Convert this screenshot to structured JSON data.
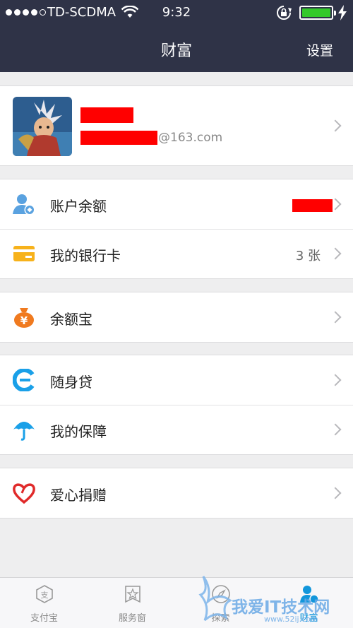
{
  "status_bar": {
    "carrier": "TD-SCDMA",
    "time": "9:32",
    "signal_bars_filled": 4,
    "signal_bars_total": 5,
    "battery_color": "#34c92a",
    "icons": [
      "wifi-icon",
      "rotation-lock-icon",
      "battery-icon",
      "charging-icon"
    ]
  },
  "nav": {
    "title": "财富",
    "settings_label": "设置"
  },
  "profile": {
    "email_domain": "@163.com"
  },
  "groups": [
    [
      {
        "label": "账户余额",
        "value": "",
        "icon": "account-balance-icon"
      },
      {
        "label": "我的银行卡",
        "value": "3 张",
        "icon": "bank-card-icon"
      }
    ],
    [
      {
        "label": "余额宝",
        "icon": "yuebao-bag-icon"
      }
    ],
    [
      {
        "label": "随身贷",
        "icon": "loan-icon"
      },
      {
        "label": "我的保障",
        "icon": "umbrella-icon"
      }
    ],
    [
      {
        "label": "爱心捐赠",
        "icon": "heart-icon"
      }
    ]
  ],
  "tabs": [
    {
      "label": "支付宝",
      "icon": "alipay-icon",
      "active": false
    },
    {
      "label": "服务窗",
      "icon": "service-window-icon",
      "active": false
    },
    {
      "label": "探索",
      "icon": "explore-icon",
      "active": false
    },
    {
      "label": "财富",
      "icon": "wealth-icon",
      "active": true
    }
  ],
  "watermark": {
    "text": "我爱IT技术网",
    "url": "www.52ij.com"
  },
  "colors": {
    "nav_background": "#2f3347",
    "accent_blue": "#1296db",
    "redaction": "#ff0000",
    "page_background": "#eeeeef"
  }
}
